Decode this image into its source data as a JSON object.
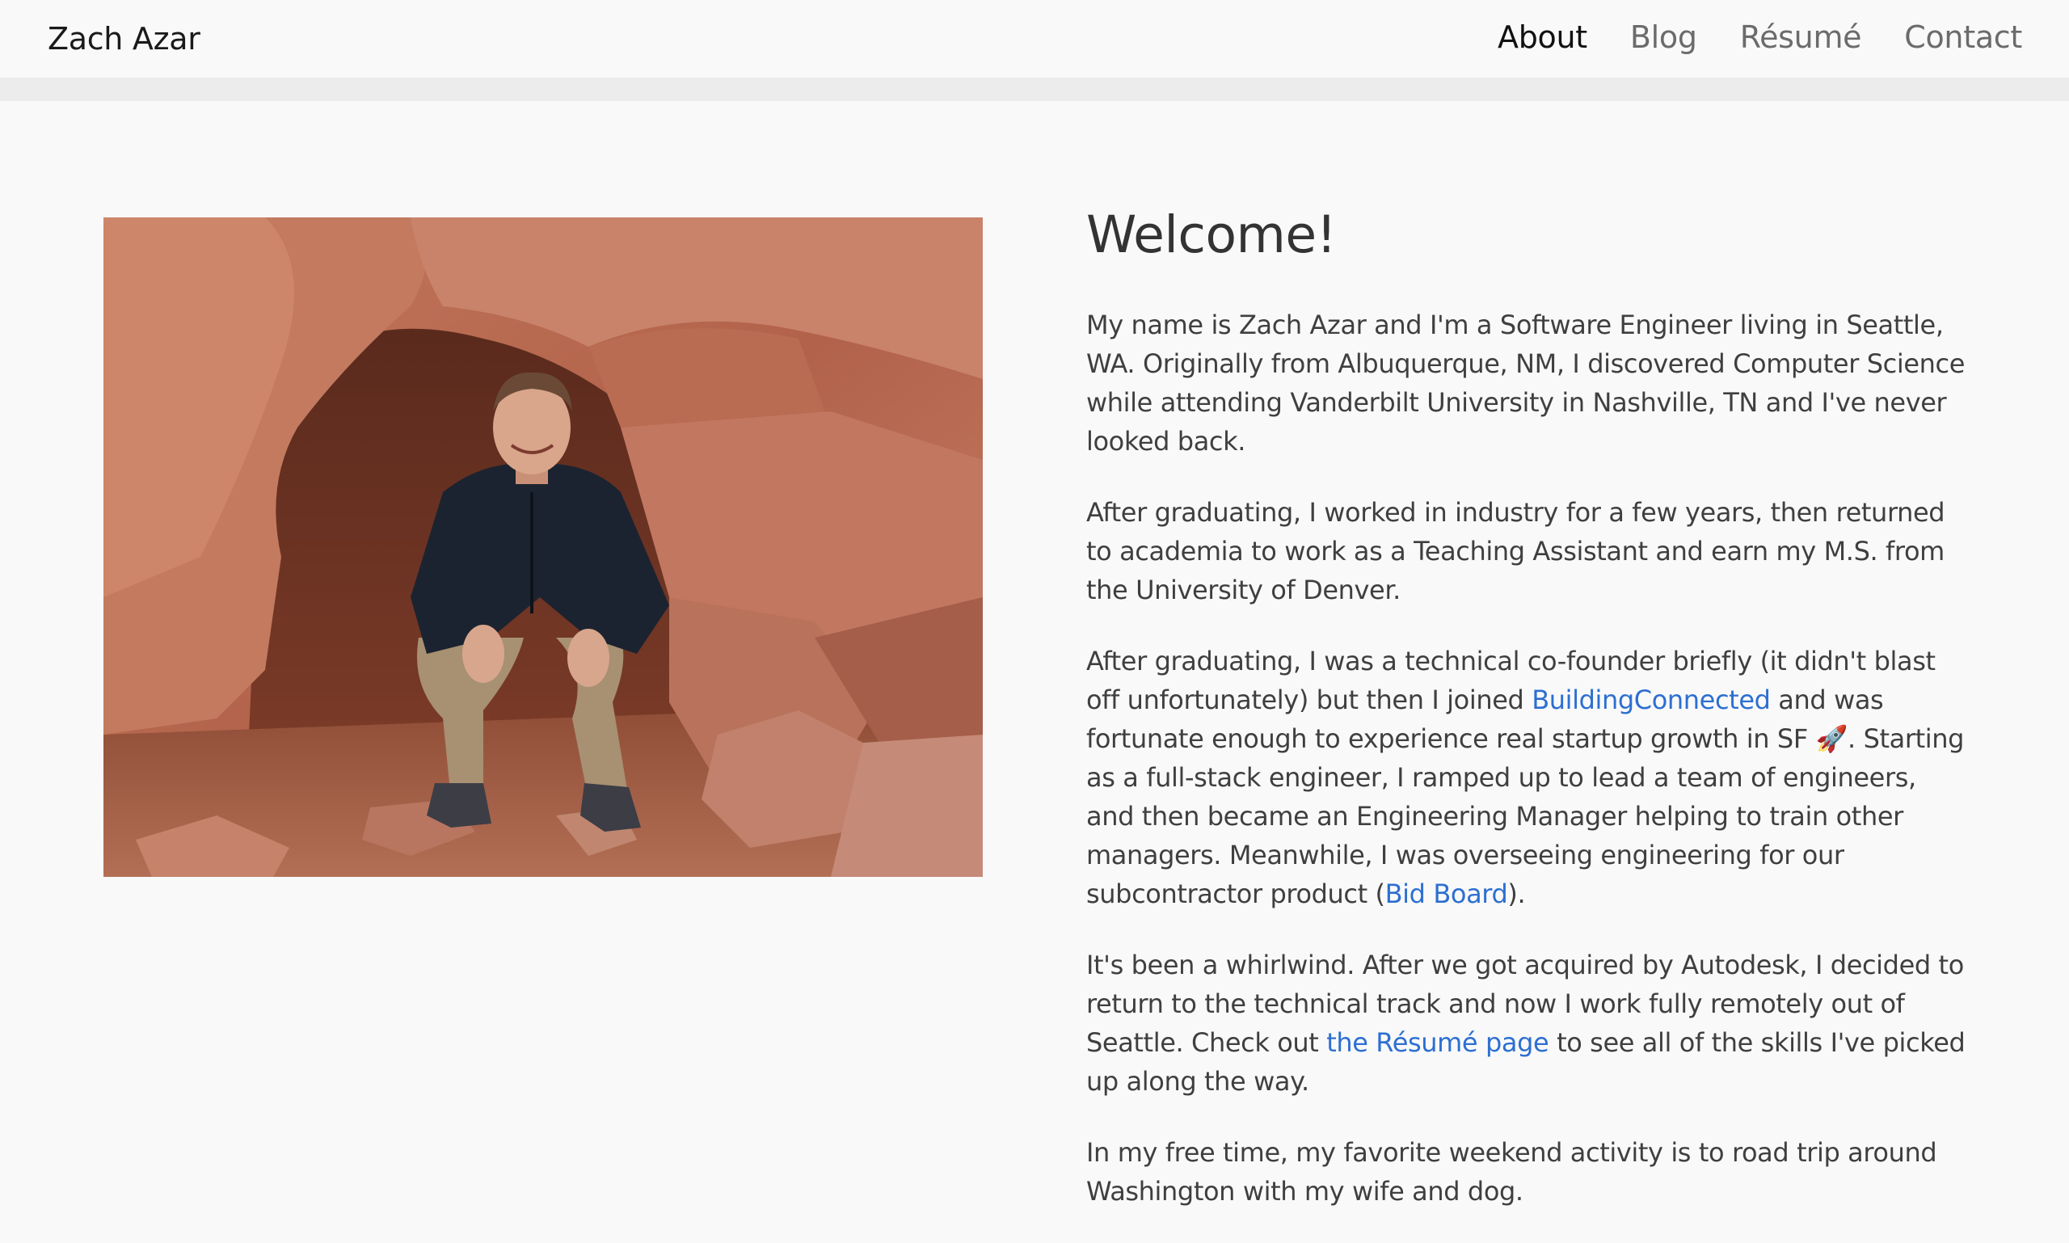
{
  "header": {
    "brand": "Zach Azar",
    "nav": [
      {
        "label": "About",
        "active": true
      },
      {
        "label": "Blog",
        "active": false
      },
      {
        "label": "Résumé",
        "active": false
      },
      {
        "label": "Contact",
        "active": false
      }
    ]
  },
  "main": {
    "title": "Welcome!",
    "p1": "My name is Zach Azar and I'm a Software Engineer living in Seattle, WA. Originally from Albuquerque, NM, I discovered Computer Science while attending Vanderbilt University in Nashville, TN and I've never looked back.",
    "p2": "After graduating, I worked in industry for a few years, then returned to academia to work as a Teaching Assistant and earn my M.S. from the University of Denver.",
    "p3": {
      "text_a": "After graduating, I was a technical co-founder briefly (it didn't blast off unfortunately) but then I joined ",
      "link_a": "BuildingConnected",
      "text_b": " and was fortunate enough to experience real startup growth in SF 🚀. Starting as a full-stack engineer, I ramped up to lead a team of engineers, and then became an Engineering Manager helping to train other managers. Meanwhile, I was overseeing engineering for our subcontractor product (",
      "link_b": "Bid Board",
      "text_c": ")."
    },
    "p4": {
      "text_a": "It's been a whirlwind. After we got acquired by Autodesk, I decided to return to the technical track and now I work fully remotely out of Seattle. Check out ",
      "link": "the Résumé page",
      "text_b": " to see all of the skills I've picked up along the way."
    },
    "p5": "In my free time, my favorite weekend activity is to road trip around Washington with my wife and dog."
  },
  "colors": {
    "link": "#2d6fd0",
    "nav_inactive": "#6b6b6b",
    "nav_active": "#111111",
    "rock": "#b86a50"
  }
}
